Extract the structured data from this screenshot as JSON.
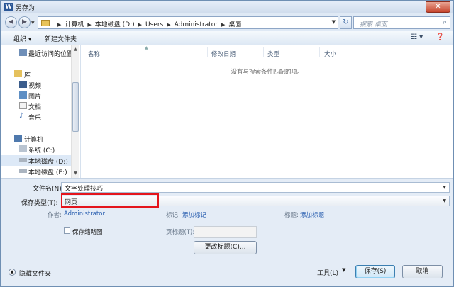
{
  "window": {
    "title": "另存为",
    "app_icon": "W"
  },
  "address": {
    "crumbs": [
      "计算机",
      "本地磁盘 (D:)",
      "Users",
      "Administrator",
      "桌面"
    ],
    "search_placeholder": "搜索 桌面"
  },
  "toolbar": {
    "organize": "组织 ▾",
    "new_folder": "新建文件夹"
  },
  "nav": {
    "recent": "最近访问的位置",
    "library": "库",
    "videos": "视频",
    "pictures": "图片",
    "documents": "文档",
    "music": "音乐",
    "computer": "计算机",
    "system_c": "系统 (C:)",
    "local_d": "本地磁盘 (D:)",
    "local_e": "本地磁盘 (E:)"
  },
  "columns": {
    "name": "名称",
    "modified": "修改日期",
    "type": "类型",
    "size": "大小"
  },
  "empty_message": "没有与搜索条件匹配的项。",
  "form": {
    "filename_label": "文件名(N):",
    "filename_value": "文字处理技巧",
    "filetype_label": "保存类型(T):",
    "filetype_value": "网页",
    "author_label": "作者:",
    "author_value": "Administrator",
    "tags_label": "标记:",
    "tags_value": "添加标记",
    "title_label": "标题:",
    "title_value": "添加标题",
    "thumbnail_label": "保存缩略图",
    "page_title_label": "页标题(T):",
    "change_title_button": "更改标题(C)..."
  },
  "footer": {
    "hide_folders": "隐藏文件夹",
    "tools": "工具(L)",
    "save": "保存(S)",
    "cancel": "取消"
  }
}
